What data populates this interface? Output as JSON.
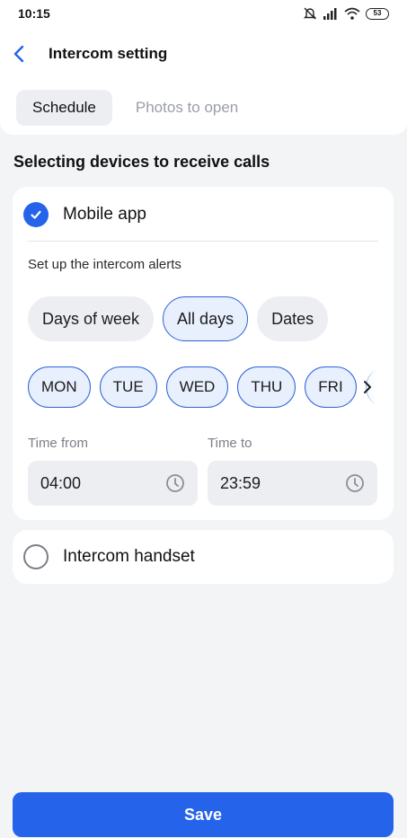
{
  "status_bar": {
    "time": "10:15",
    "battery": "53",
    "icons": [
      "bell-off-icon",
      "signal-icon",
      "wifi-icon",
      "battery-icon"
    ]
  },
  "header": {
    "title": "Intercom setting",
    "back_icon": "chevron-left-icon"
  },
  "tabs": [
    {
      "label": "Schedule",
      "active": true
    },
    {
      "label": "Photos to open",
      "active": false
    }
  ],
  "section_title": "Selecting devices to receive calls",
  "mobile_app": {
    "label": "Mobile app",
    "checked": true,
    "alerts_title": "Set up the intercom alerts",
    "modes": [
      {
        "label": "Days of week",
        "active": false
      },
      {
        "label": "All days",
        "active": true
      },
      {
        "label": "Dates",
        "active": false
      }
    ],
    "days": [
      "MON",
      "TUE",
      "WED",
      "THU",
      "FRI"
    ],
    "time_from": {
      "label": "Time from",
      "value": "04:00"
    },
    "time_to": {
      "label": "Time to",
      "value": "23:59"
    }
  },
  "handset": {
    "label": "Intercom handset",
    "checked": false
  },
  "save_label": "Save",
  "colors": {
    "accent": "#2563eb",
    "chip_active_bg": "#e8effd",
    "chip_border": "#2e62d9",
    "chip_bg": "#eceef2",
    "page_bg": "#f3f4f6"
  }
}
